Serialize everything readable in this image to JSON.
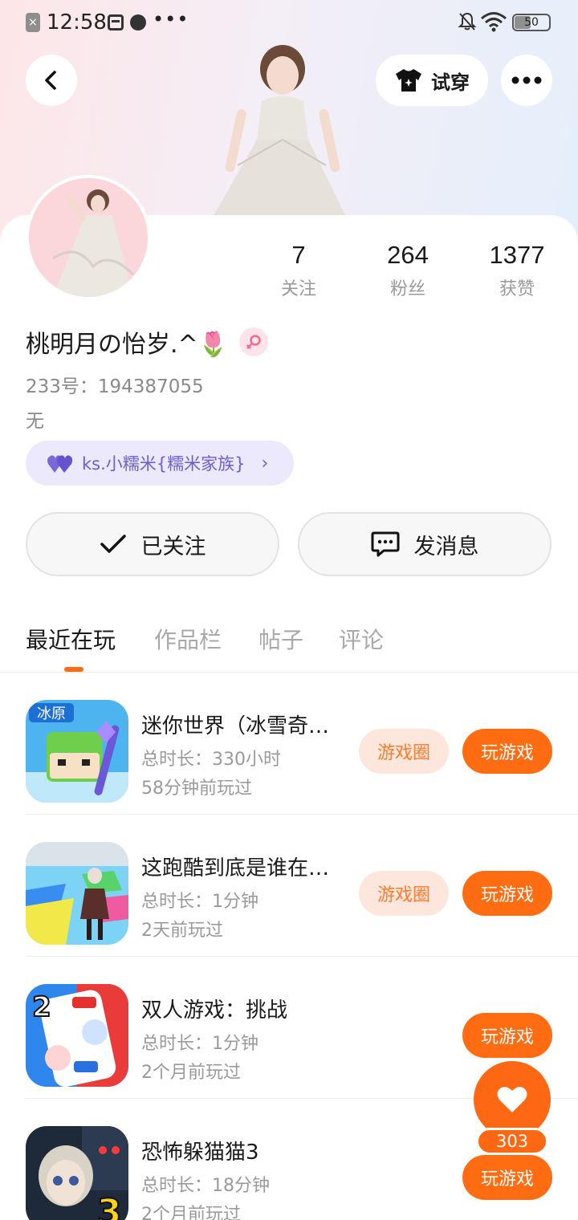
{
  "status_bar": {
    "time": "12:58",
    "battery": "50"
  },
  "header": {
    "tryon_label": "试穿"
  },
  "profile": {
    "stats": [
      {
        "value": "7",
        "label": "关注"
      },
      {
        "value": "264",
        "label": "粉丝"
      },
      {
        "value": "1377",
        "label": "获赞"
      }
    ],
    "username": "桃明月の怡岁.^🌷",
    "uid": "233号：194387055",
    "bio": "无",
    "family": "ks.小糯米{糯米家族}"
  },
  "actions": {
    "follow_label": "已关注",
    "message_label": "发消息"
  },
  "tabs": [
    "最近在玩",
    "作品栏",
    "帖子",
    "评论"
  ],
  "games": [
    {
      "title": "迷你世界（冰雪奇…",
      "duration": "总时长：330小时",
      "last": "58分钟前玩过",
      "circle": "游戏圈",
      "play": "玩游戏",
      "icon_text": "冰原"
    },
    {
      "title": "这跑酷到底是谁在…",
      "duration": "总时长：1分钟",
      "last": "2天前玩过",
      "circle": "游戏圈",
      "play": "玩游戏"
    },
    {
      "title": "双人游戏：挑战",
      "duration": "总时长：1分钟",
      "last": "2个月前玩过",
      "play": "玩游戏",
      "icon_text": "2"
    },
    {
      "title": "恐怖躲猫猫3",
      "duration": "总时长：18分钟",
      "last": "2个月前玩过",
      "play": "玩游戏",
      "icon_text": "3"
    }
  ],
  "like": {
    "count": "303"
  },
  "colors": {
    "accent": "#ff6c12",
    "family_pill": "#ebe9fb",
    "family_text": "#6c5fcf"
  }
}
